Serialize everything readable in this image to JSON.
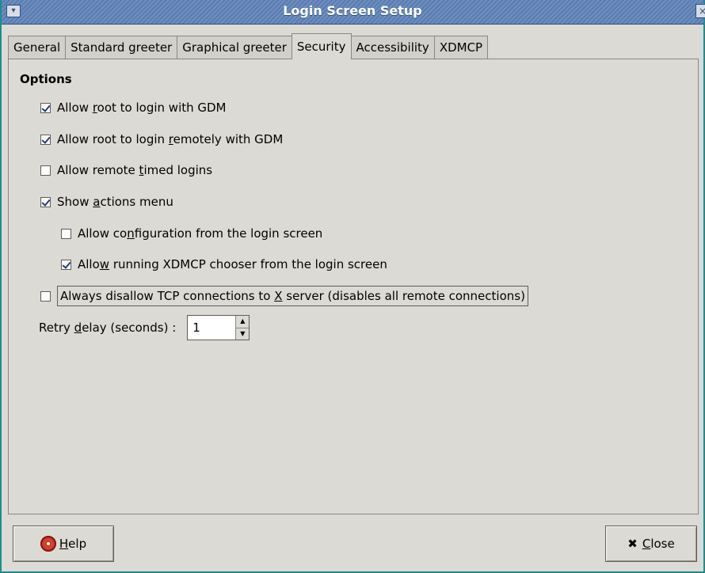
{
  "window": {
    "title": "Login Screen Setup",
    "menu_glyph": "▾",
    "close_glyph": "×"
  },
  "tabs": [
    {
      "label": "General"
    },
    {
      "label": "Standard greeter"
    },
    {
      "label": "Graphical greeter"
    },
    {
      "label": "Security",
      "active": true
    },
    {
      "label": "Accessibility"
    },
    {
      "label": "XDMCP"
    }
  ],
  "options": {
    "section_title": "Options",
    "allow_root_gdm": {
      "pre": "Allow ",
      "mn": "r",
      "post": "oot to login with GDM",
      "checked": true
    },
    "allow_root_remote": {
      "pre": "Allow root to login ",
      "mn": "r",
      "post": "emotely with GDM",
      "checked": true
    },
    "allow_remote_timed": {
      "pre": "Allow remote ",
      "mn": "t",
      "post": "imed logins",
      "checked": false
    },
    "show_actions_menu": {
      "pre": "Show ",
      "mn": "a",
      "post": "ctions menu",
      "checked": true
    },
    "allow_config": {
      "pre": "Allow co",
      "mn": "n",
      "post": "figuration from the login screen",
      "checked": false
    },
    "allow_xdmcp_chooser": {
      "pre": "Allo",
      "mn": "w",
      "post": " running XDMCP chooser from the login screen",
      "checked": true
    },
    "disallow_tcp": {
      "pre": "Always disallow TCP connections to ",
      "mn": "X",
      "post": " server (disables all remote connections)",
      "checked": false
    }
  },
  "retry": {
    "pre": "Retry ",
    "mn": "d",
    "post": "elay (seconds) :",
    "value": "1"
  },
  "buttons": {
    "help": {
      "mn": "H",
      "post": "elp"
    },
    "close": {
      "mn": "C",
      "post": "lose"
    }
  }
}
